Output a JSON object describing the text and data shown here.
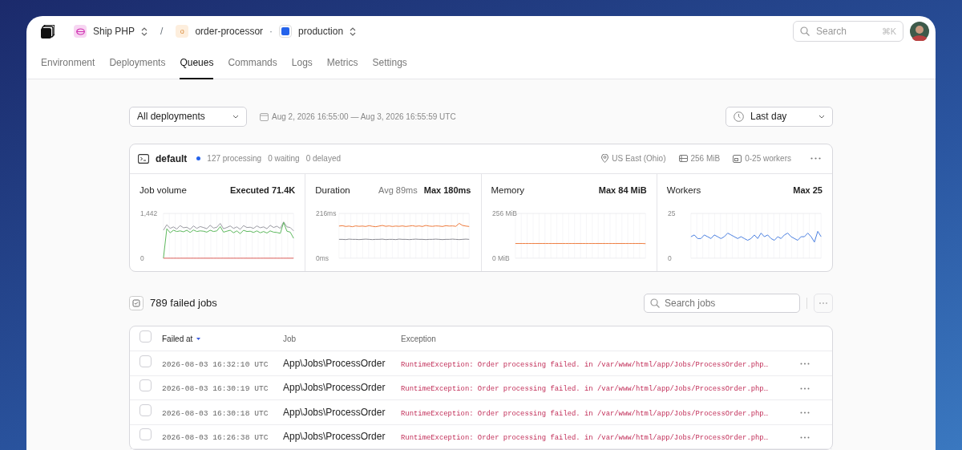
{
  "breadcrumbs": {
    "org": {
      "label": "Ship PHP"
    },
    "separator": "/",
    "app": {
      "label": "order-processor",
      "icon_letter": "o"
    },
    "dot": "·",
    "environment": {
      "label": "production"
    }
  },
  "search": {
    "placeholder": "Search",
    "shortcut": "⌘K"
  },
  "tabs": [
    {
      "label": "Environment",
      "selected": false
    },
    {
      "label": "Deployments",
      "selected": false
    },
    {
      "label": "Queues",
      "selected": true
    },
    {
      "label": "Commands",
      "selected": false
    },
    {
      "label": "Logs",
      "selected": false
    },
    {
      "label": "Metrics",
      "selected": false
    },
    {
      "label": "Settings",
      "selected": false
    }
  ],
  "filters": {
    "deployment": "All deployments",
    "date_range": "Aug 2, 2026 16:55:00 — Aug 3, 2026 16:55:59 UTC",
    "period": "Last day"
  },
  "queue": {
    "name": "default",
    "counts": [
      "127 processing",
      "0 waiting",
      "0 delayed"
    ],
    "region": "US East (Ohio)",
    "memory": "256 MiB",
    "workers": "0-25 workers",
    "metrics": [
      {
        "title": "Job volume",
        "stats": [
          {
            "kind": "strong",
            "text": "Executed 71.4K"
          }
        ],
        "chart_data": {
          "type": "line",
          "grid": true,
          "ylim": [
            0,
            1442
          ],
          "yticks": [
            {
              "value": 0,
              "label": "0"
            },
            {
              "value": 1442,
              "label": "1,442"
            }
          ],
          "series": [
            {
              "color": "#9a9aa2",
              "values": [
                900,
                1080,
                960,
                1010,
                940,
                1050,
                980,
                1000,
                930,
                1040,
                960,
                1020,
                990,
                950,
                1060,
                970,
                1000,
                1120,
                950,
                990,
                1040,
                960,
                1010,
                930,
                1050,
                990,
                1000,
                960,
                1040,
                980,
                1010,
                950,
                1060,
                990,
                1030,
                960,
                1170,
                1010,
                990,
                880
              ]
            },
            {
              "color": "#5cb85c",
              "values": [
                0,
                950,
                820,
                900,
                860,
                880,
                850,
                900,
                830,
                910,
                860,
                880,
                870,
                840,
                900,
                860,
                880,
                1020,
                840,
                870,
                900,
                820,
                880,
                790,
                900,
                860,
                870,
                830,
                880,
                820,
                860,
                810,
                880,
                840,
                830,
                800,
                1150,
                870,
                840,
                640
              ]
            },
            {
              "color": "#e0605a",
              "values": [
                0,
                0,
                0,
                0,
                0,
                0,
                0,
                0,
                0,
                0,
                0,
                0,
                0,
                0,
                0,
                0,
                0,
                0,
                0,
                0,
                0,
                0,
                0,
                0,
                0,
                0,
                0,
                0,
                0,
                0,
                0,
                0,
                0,
                0,
                0,
                0,
                0,
                0,
                0,
                0
              ]
            }
          ]
        }
      },
      {
        "title": "Duration",
        "stats": [
          {
            "kind": "muted",
            "text": "Avg 89ms"
          },
          {
            "kind": "strong",
            "text": "Max 180ms"
          }
        ],
        "chart_data": {
          "type": "line",
          "grid": true,
          "ylim": [
            0,
            216
          ],
          "yticks": [
            {
              "value": 0,
              "label": "0ms"
            },
            {
              "value": 216,
              "label": "216ms"
            }
          ],
          "series": [
            {
              "color": "#ee7a3c",
              "values": [
                155,
                157,
                153,
                155,
                152,
                156,
                154,
                155,
                153,
                157,
                154,
                152,
                155,
                158,
                154,
                156,
                153,
                155,
                154,
                156,
                153,
                155,
                157,
                154,
                156,
                153,
                158,
                155,
                154,
                156,
                155,
                153,
                157,
                155,
                156,
                154,
                168,
                158,
                155,
                153
              ]
            },
            {
              "color": "#8a8a92",
              "values": [
                91,
                91,
                90,
                92,
                91,
                91,
                90,
                91,
                92,
                91,
                90,
                91,
                91,
                92,
                90,
                91,
                91,
                90,
                92,
                91,
                91,
                90,
                91,
                92,
                91,
                91,
                90,
                91,
                91,
                92,
                91,
                90,
                91,
                91,
                92,
                91,
                90,
                91,
                92,
                91
              ]
            }
          ]
        }
      },
      {
        "title": "Memory",
        "stats": [
          {
            "kind": "strong",
            "text": "Max 84 MiB"
          }
        ],
        "chart_data": {
          "type": "line",
          "grid": true,
          "ylim": [
            0,
            256
          ],
          "yticks": [
            {
              "value": 0,
              "label": "0 MiB"
            },
            {
              "value": 256,
              "label": "256 MiB"
            }
          ],
          "series": [
            {
              "color": "#ee7a3c",
              "values": [
                84,
                84,
                84,
                84,
                84,
                84,
                84,
                84,
                84,
                84,
                84,
                84,
                84,
                84,
                84,
                84,
                84,
                84,
                84,
                84,
                84,
                84,
                84,
                84,
                84,
                84,
                84,
                84,
                84,
                84,
                84,
                84,
                84,
                84,
                84,
                84,
                84,
                84,
                84,
                83
              ]
            }
          ]
        }
      },
      {
        "title": "Workers",
        "stats": [
          {
            "kind": "strong",
            "text": "Max 25"
          }
        ],
        "chart_data": {
          "type": "line",
          "grid": true,
          "ylim": [
            0,
            25
          ],
          "yticks": [
            {
              "value": 0,
              "label": "0"
            },
            {
              "value": 25,
              "label": "25"
            }
          ],
          "series": [
            {
              "color": "#4a7fe0",
              "values": [
                12,
                13,
                11,
                11,
                13,
                12,
                11,
                13,
                12,
                11,
                12,
                14,
                13,
                12,
                11,
                12,
                11,
                10,
                11,
                13,
                11,
                14,
                12,
                13,
                11,
                10,
                12,
                11,
                13,
                14,
                12,
                11,
                10,
                12,
                12,
                14,
                12,
                9,
                15,
                12
              ]
            }
          ]
        }
      }
    ]
  },
  "failed_jobs": {
    "title": "789 failed jobs",
    "search_placeholder": "Search jobs",
    "select_all": {
      "checked": false
    },
    "columns": [
      {
        "label": "Failed at",
        "sorted": true
      },
      {
        "label": "Job",
        "sorted": false
      },
      {
        "label": "Exception",
        "sorted": false
      }
    ],
    "rows": [
      {
        "selected": false,
        "failed_at": "2026-08-03 16:32:10 UTC",
        "job": "App\\Jobs\\ProcessOrder",
        "exception": "RuntimeException: Order processing failed. in /var/www/html/app/Jobs/ProcessOrder.php…"
      },
      {
        "selected": false,
        "failed_at": "2026-08-03 16:30:19 UTC",
        "job": "App\\Jobs\\ProcessOrder",
        "exception": "RuntimeException: Order processing failed. in /var/www/html/app/Jobs/ProcessOrder.php…"
      },
      {
        "selected": false,
        "failed_at": "2026-08-03 16:30:18 UTC",
        "job": "App\\Jobs\\ProcessOrder",
        "exception": "RuntimeException: Order processing failed. in /var/www/html/app/Jobs/ProcessOrder.php…"
      },
      {
        "selected": false,
        "failed_at": "2026-08-03 16:26:38 UTC",
        "job": "App\\Jobs\\ProcessOrder",
        "exception": "RuntimeException: Order processing failed. in /var/www/html/app/Jobs/ProcessOrder.php…"
      }
    ]
  }
}
